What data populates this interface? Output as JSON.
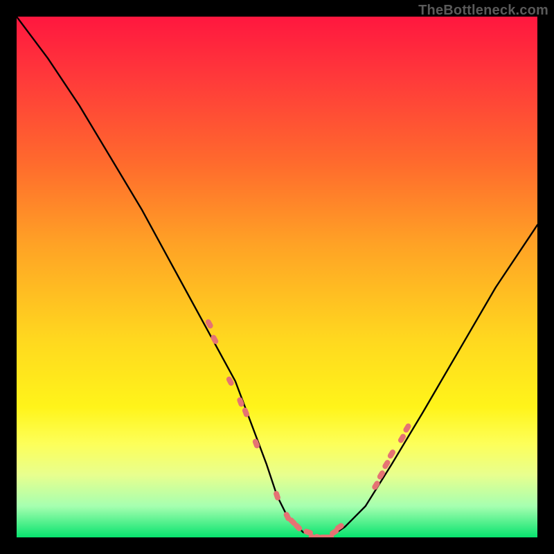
{
  "watermark": "TheBottleneck.com",
  "chart_data": {
    "type": "line",
    "title": "",
    "xlabel": "",
    "ylabel": "",
    "xlim": [
      0,
      100
    ],
    "ylim": [
      0,
      100
    ],
    "grid": false,
    "legend": false,
    "series": [
      {
        "name": "bottleneck-curve",
        "color": "#000000",
        "x": [
          0,
          6,
          12,
          18,
          24,
          30,
          36,
          42,
          48,
          50,
          52,
          55,
          58,
          60,
          63,
          67,
          72,
          78,
          85,
          92,
          100
        ],
        "values": [
          100,
          92,
          83,
          73,
          63,
          52,
          41,
          30,
          14,
          8,
          4,
          1,
          0,
          0,
          2,
          6,
          14,
          24,
          36,
          48,
          60
        ]
      }
    ],
    "markers": {
      "name": "highlighted-points",
      "color": "#e57373",
      "shape": "rounded-pill",
      "points": [
        {
          "x": 37,
          "y": 41
        },
        {
          "x": 38,
          "y": 38
        },
        {
          "x": 41,
          "y": 30
        },
        {
          "x": 43,
          "y": 26
        },
        {
          "x": 44,
          "y": 24
        },
        {
          "x": 46,
          "y": 18
        },
        {
          "x": 50,
          "y": 8
        },
        {
          "x": 52,
          "y": 4
        },
        {
          "x": 53,
          "y": 3
        },
        {
          "x": 54,
          "y": 2
        },
        {
          "x": 56,
          "y": 1
        },
        {
          "x": 57,
          "y": 0
        },
        {
          "x": 58,
          "y": 0
        },
        {
          "x": 59,
          "y": 0
        },
        {
          "x": 60,
          "y": 0
        },
        {
          "x": 61,
          "y": 1
        },
        {
          "x": 62,
          "y": 2
        },
        {
          "x": 69,
          "y": 10
        },
        {
          "x": 70,
          "y": 12
        },
        {
          "x": 71,
          "y": 14
        },
        {
          "x": 72,
          "y": 16
        },
        {
          "x": 74,
          "y": 19
        },
        {
          "x": 75,
          "y": 21
        }
      ]
    }
  }
}
